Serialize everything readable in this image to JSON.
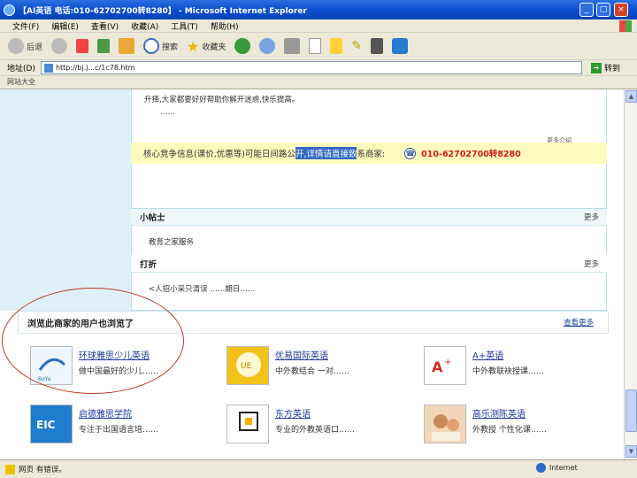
{
  "window": {
    "title": "【AI英语 电话:010-62702700转8280】 - Microsoft Internet Explorer"
  },
  "menu": [
    "文件(F)",
    "编辑(E)",
    "查看(V)",
    "收藏(A)",
    "工具(T)",
    "帮助(H)"
  ],
  "toolbar": {
    "back": "后退",
    "search": "搜索",
    "favorites": "收藏夹"
  },
  "address": {
    "label": "地址(D)",
    "value": "http://bj.j...c/1c78.htm",
    "go": "转到"
  },
  "links": {
    "label": "网站大全"
  },
  "page": {
    "intro_line1": "升择,大家都要好好帮助你解开迷惑,快乐提高。",
    "intro_line2": "……",
    "more_small": "更多介绍",
    "contact_text_before": "核心竞争信息(课价,优惠等)可能日间路公",
    "contact_selected": "开,详情请直接致",
    "contact_text_after": "系商家:",
    "phone_icon": "phone-icon",
    "phone": "010-62702700转8280",
    "tips": {
      "title": "小帖士",
      "more": "更多",
      "item": "教育之家服务"
    },
    "news": {
      "title": "打折",
      "more": "更多",
      "item": "<人招小采只清误 ……期日……"
    },
    "recommend": {
      "title": "浏览此商家的用户也浏览了",
      "more": "查看更多",
      "cards": [
        {
          "name": "环球雅思少儿英语",
          "desc": "做中国最好的少儿……",
          "logo": "boya-logo"
        },
        {
          "name": "优易国际英语",
          "desc": "中外教结合 一对……",
          "logo": "youyi-logo"
        },
        {
          "name": "A+英语",
          "desc": "中外教联袂授课……",
          "logo": "aplus-logo"
        },
        {
          "name": "启德雅思学院",
          "desc": "专注于出国语言培……",
          "logo": "eic-logo"
        },
        {
          "name": "东方英语",
          "desc": "专业的外教英语口……",
          "logo": "dongfang-logo"
        },
        {
          "name": "高乐测陈英语",
          "desc": "外教授 个性化课……",
          "logo": "gaole-logo"
        }
      ]
    }
  },
  "status": {
    "left": "网页 有错误。",
    "zone": "Internet"
  }
}
